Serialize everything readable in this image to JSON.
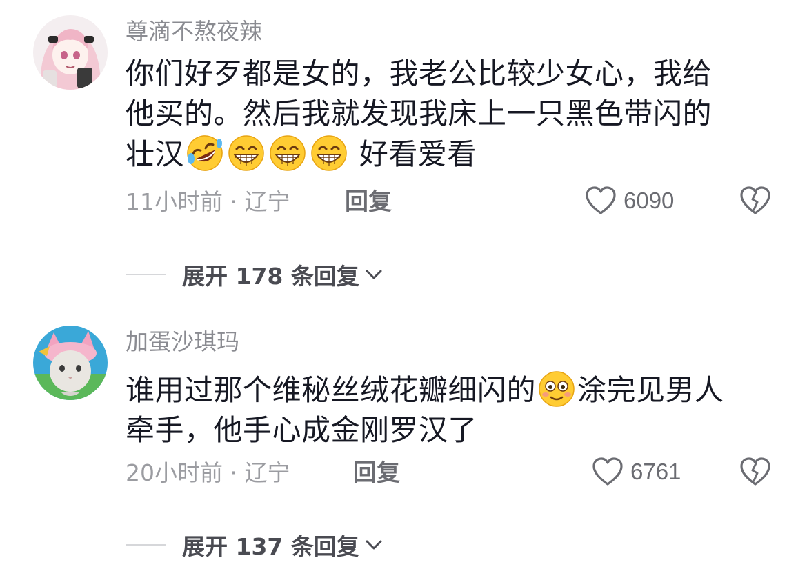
{
  "comments": [
    {
      "username": "尊滴不熬夜辣",
      "text_line1": "你们好歹都是女的，我老公比较少女心，我给",
      "text_line2": "他买的。然后我就发现我床上一只黑色带闪的",
      "text_line3_pre": "壮汉",
      "text_line3_post": " 好看爱看",
      "emojis": [
        "rofl-emoji",
        "grin-emoji",
        "grin-emoji",
        "grin-emoji"
      ],
      "time": "11小时前",
      "dot": "·",
      "location": "辽宁",
      "reply_label": "回复",
      "likes": "6090",
      "expand_label": "展开 178 条回复"
    },
    {
      "username": "加蛋沙琪玛",
      "text_line1_pre": "谁用过那个维秘丝绒花瓣细闪的",
      "text_line1_post": "涂完见男人",
      "text_line2": "牵手，他手心成金刚罗汉了",
      "emojis": [
        "flushed-emoji"
      ],
      "time": "20小时前",
      "dot": "·",
      "location": "辽宁",
      "reply_label": "回复",
      "likes": "6761",
      "expand_label": "展开 137 条回复"
    }
  ],
  "colors": {
    "text": "#161823",
    "username": "#8a8b91",
    "meta": "#9b9ca1",
    "action": "#6b6c72"
  }
}
